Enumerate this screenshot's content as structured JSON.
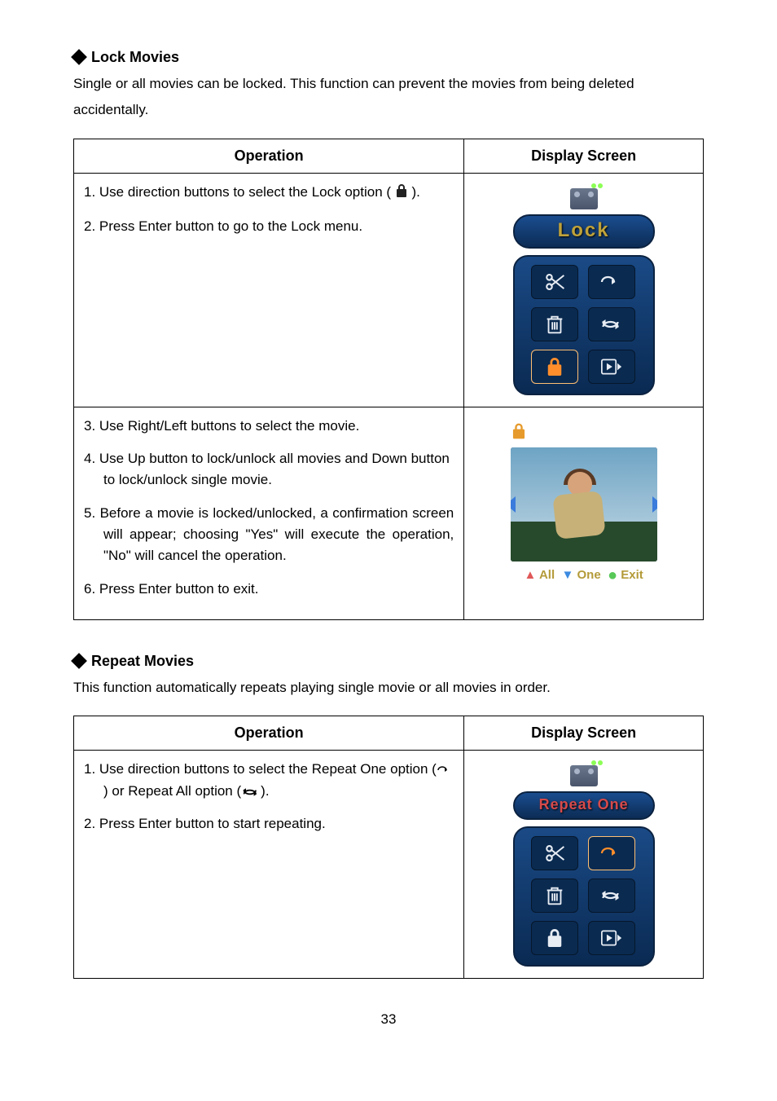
{
  "section1": {
    "heading": "Lock Movies",
    "intro": "Single or all movies can be locked. This function can prevent the movies from being deleted accidentally.",
    "table": {
      "col1": "Operation",
      "col2": "Display Screen",
      "row1": {
        "step1a": "1. Use direction buttons to select the Lock option (",
        "step1b": ").",
        "step2": "2. Press Enter button to go to the Lock menu.",
        "title_pill": "Lock"
      },
      "row2": {
        "step3": "3. Use Right/Left buttons to select the movie.",
        "step4": "4. Use Up button to lock/unlock all movies and Down button to lock/unlock single movie.",
        "step5": "5. Before a movie is locked/unlocked, a confirmation screen will appear; choosing \"Yes\" will execute the operation, \"No\" will cancel the operation.",
        "step6": "6. Press Enter button to exit.",
        "legend": {
          "all": "All",
          "one": "One",
          "exit": "Exit"
        }
      }
    }
  },
  "section2": {
    "heading": "Repeat Movies",
    "intro": "This function automatically repeats playing single movie or all movies in order.",
    "table": {
      "col1": "Operation",
      "col2": "Display Screen",
      "row1": {
        "step1a": "1. Use direction buttons to select the Repeat One option (",
        "step1b": ") or Repeat All option (",
        "step1c": ").",
        "step2": "2. Press Enter button to start repeating.",
        "title_pill": "Repeat One"
      }
    }
  },
  "page_number": "33"
}
